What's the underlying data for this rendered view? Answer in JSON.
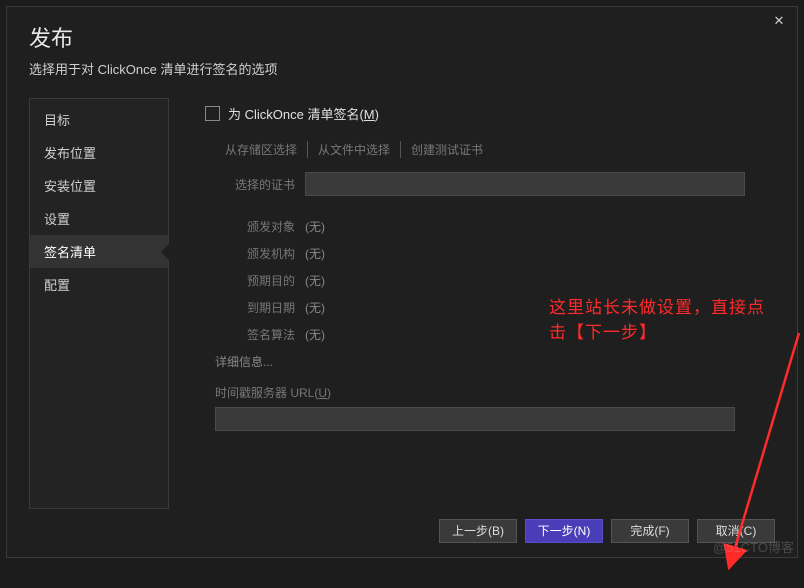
{
  "header": {
    "title": "发布",
    "subtitle": "选择用于对 ClickOnce 清单进行签名的选项"
  },
  "close_icon": "✕",
  "sidebar": {
    "items": [
      {
        "label": "目标"
      },
      {
        "label": "发布位置"
      },
      {
        "label": "安装位置"
      },
      {
        "label": "设置"
      },
      {
        "label": "签名清单",
        "selected": true
      },
      {
        "label": "配置"
      }
    ]
  },
  "main": {
    "checkbox_label": "为 ClickOnce 清单签名(",
    "checkbox_hotkey": "M",
    "checkbox_label_end": ")",
    "tabs": [
      {
        "label": "从存储区选择"
      },
      {
        "label": "从文件中选择"
      },
      {
        "label": "创建测试证书"
      }
    ],
    "selected_cert_label": "选择的证书",
    "fields": [
      {
        "label": "颁发对象",
        "value": "(无)"
      },
      {
        "label": "颁发机构",
        "value": "(无)"
      },
      {
        "label": "预期目的",
        "value": "(无)"
      },
      {
        "label": "到期日期",
        "value": "(无)"
      },
      {
        "label": "签名算法",
        "value": "(无)"
      }
    ],
    "detail_link": "详细信息...",
    "ts_label_prefix": "时间戳服务器 URL(",
    "ts_hotkey": "U",
    "ts_label_end": ")"
  },
  "annotation": "这里站长未做设置，直接点击【下一步】",
  "footer": {
    "prev": "上一步(B)",
    "next": "下一步(N)",
    "finish": "完成(F)",
    "cancel": "取消(C)"
  },
  "watermark": "@51CTO博客"
}
